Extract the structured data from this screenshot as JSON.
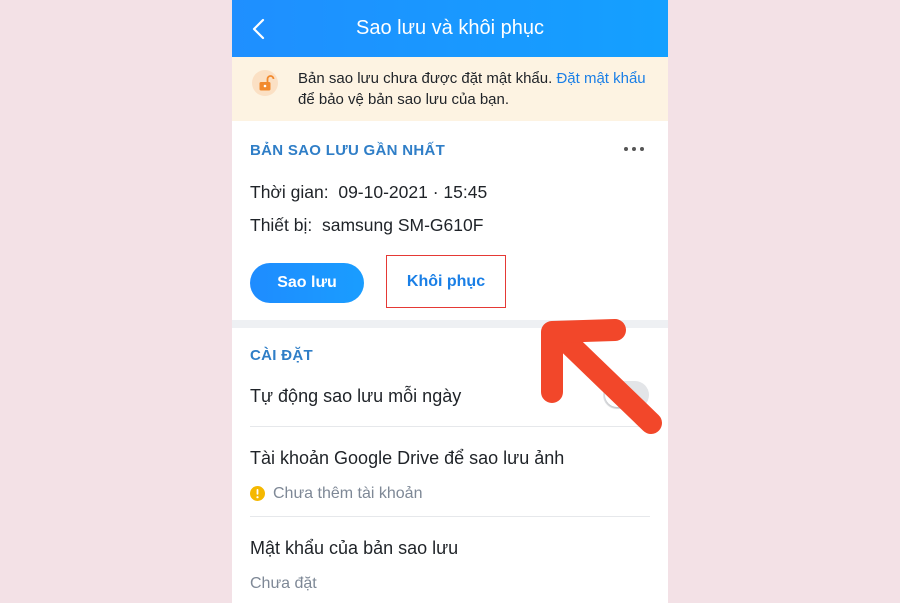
{
  "header": {
    "title": "Sao lưu và khôi phục"
  },
  "warning": {
    "text_before": "Bản sao lưu chưa được đặt mật khẩu. ",
    "link_text": "Đặt mật khẩu",
    "text_after": " để bảo vệ bản sao lưu của bạn."
  },
  "latest_backup": {
    "section_title": "BẢN SAO LƯU GẦN NHẤT",
    "time_label": "Thời gian:",
    "time_value": "09-10-2021 · 15:45",
    "device_label": "Thiết bị:",
    "device_value": "samsung SM-G610F",
    "backup_button": "Sao lưu",
    "restore_button": "Khôi phục"
  },
  "settings": {
    "section_title": "CÀI ĐẶT",
    "auto_backup_label": "Tự động sao lưu mỗi ngày",
    "auto_backup_enabled": false,
    "google_drive_label": "Tài khoản Google Drive để sao lưu ảnh",
    "google_drive_status": "Chưa thêm tài khoản",
    "password_label": "Mật khẩu của bản sao lưu",
    "password_status": "Chưa đặt"
  },
  "colors": {
    "header": "#1f8fff",
    "accent_link": "#1a7fe6",
    "highlight_box": "#e53935",
    "annotation_arrow": "#f2472a",
    "warning_bg": "#fdf3e2"
  },
  "icons": [
    "back-icon",
    "unlocked-lock-icon",
    "more-icon",
    "alert-icon",
    "annotation-arrow"
  ]
}
